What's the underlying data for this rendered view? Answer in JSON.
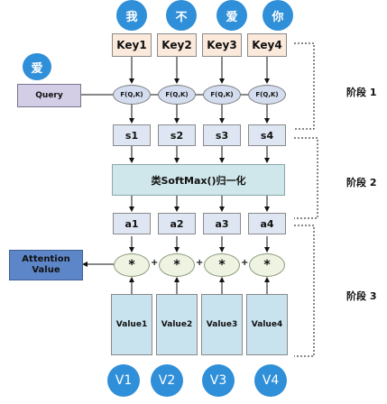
{
  "top_tokens": [
    "我",
    "不",
    "爱",
    "你"
  ],
  "left_token": "爱",
  "query_label": "Query",
  "keys": [
    "Key1",
    "Key2",
    "Key3",
    "Key4"
  ],
  "func_label": "F(Q,K)",
  "scores": [
    "s1",
    "s2",
    "s3",
    "s4"
  ],
  "softmax_label": "类SoftMax()归一化",
  "weights": [
    "a1",
    "a2",
    "a3",
    "a4"
  ],
  "multiply_symbol": "*",
  "plus_symbol": "+",
  "values": [
    "Value1",
    "Value2",
    "Value3",
    "Value4"
  ],
  "value_tokens": [
    "V1",
    "V2",
    "V3",
    "V4"
  ],
  "output_lines": [
    "Attention",
    "Value"
  ],
  "stages": [
    "阶段 1",
    "阶段 2",
    "阶段 3"
  ],
  "colors": {
    "token_circle": "#2f8fd8",
    "key_box": "#fbe9dc",
    "ellipse": "#d4ddef",
    "score_box": "#dfe6f3",
    "softmax_box": "#cfe6ea",
    "star_ellipse": "#eef3e2",
    "value_box": "#c9e3ee",
    "query_box": "#d3cde6",
    "attention_box": "#5d86c9"
  }
}
